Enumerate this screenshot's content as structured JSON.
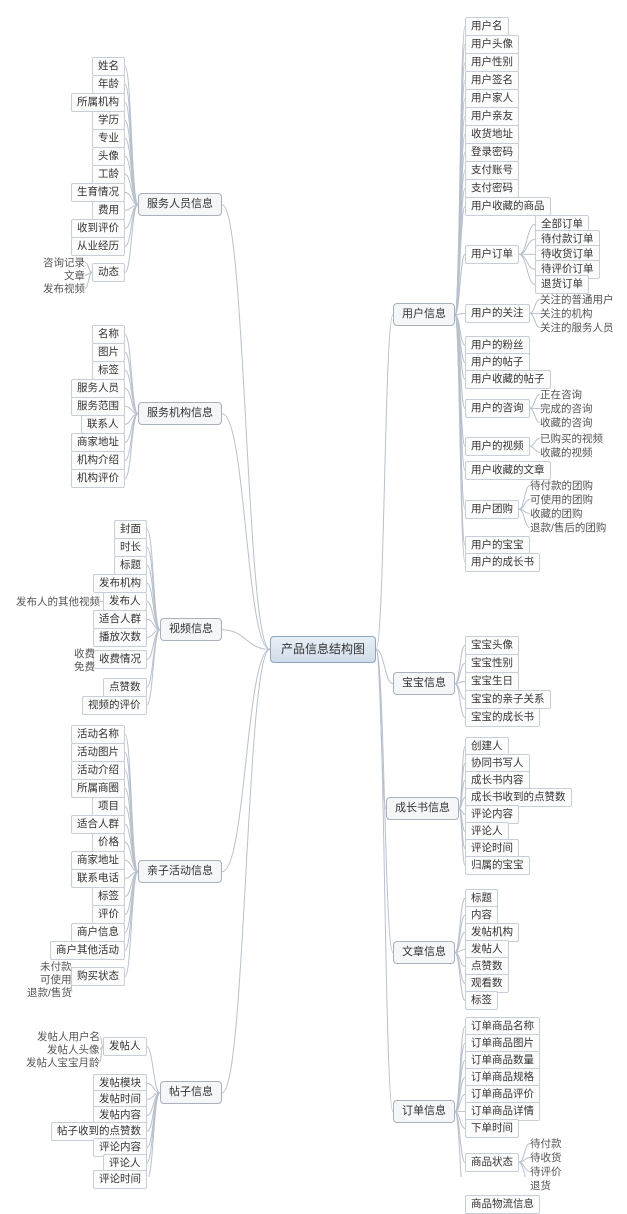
{
  "root": "产品信息结构图",
  "chart_data": {
    "type": "mindmap",
    "root": "产品信息结构图",
    "branches": [
      {
        "side": "right",
        "name": "用户信息",
        "children": [
          {
            "name": "用户名"
          },
          {
            "name": "用户头像"
          },
          {
            "name": "用户性别"
          },
          {
            "name": "用户签名"
          },
          {
            "name": "用户家人"
          },
          {
            "name": "用户亲友"
          },
          {
            "name": "收货地址"
          },
          {
            "name": "登录密码"
          },
          {
            "name": "支付账号"
          },
          {
            "name": "支付密码"
          },
          {
            "name": "用户收藏的商品"
          },
          {
            "name": "用户订单",
            "children": [
              "全部订单",
              "待付款订单",
              "待收货订单",
              "待评价订单",
              "退货订单"
            ]
          },
          {
            "name": "用户的关注",
            "children": [
              "关注的普通用户",
              "关注的机构",
              "关注的服务人员"
            ]
          },
          {
            "name": "用户的粉丝"
          },
          {
            "name": "用户的帖子"
          },
          {
            "name": "用户收藏的帖子"
          },
          {
            "name": "用户的咨询",
            "children": [
              "正在咨询",
              "完成的咨询",
              "收藏的咨询"
            ]
          },
          {
            "name": "用户的视频",
            "children": [
              "已购买的视频",
              "收藏的视频"
            ]
          },
          {
            "name": "用户收藏的文章"
          },
          {
            "name": "用户团购",
            "children": [
              "待付款的团购",
              "可使用的团购",
              "收藏的团购",
              "退款/售后的团购"
            ]
          },
          {
            "name": "用户的宝宝"
          },
          {
            "name": "用户的成长书"
          }
        ]
      },
      {
        "side": "right",
        "name": "宝宝信息",
        "children": [
          {
            "name": "宝宝头像"
          },
          {
            "name": "宝宝性别"
          },
          {
            "name": "宝宝生日"
          },
          {
            "name": "宝宝的亲子关系"
          },
          {
            "name": "宝宝的成长书"
          }
        ]
      },
      {
        "side": "right",
        "name": "成长书信息",
        "children": [
          {
            "name": "创建人"
          },
          {
            "name": "协同书写人"
          },
          {
            "name": "成长书内容"
          },
          {
            "name": "成长书收到的点赞数"
          },
          {
            "name": "评论内容"
          },
          {
            "name": "评论人"
          },
          {
            "name": "评论时间"
          },
          {
            "name": "归属的宝宝"
          }
        ]
      },
      {
        "side": "right",
        "name": "文章信息",
        "children": [
          {
            "name": "标题"
          },
          {
            "name": "内容"
          },
          {
            "name": "发帖机构"
          },
          {
            "name": "发帖人"
          },
          {
            "name": "点赞数"
          },
          {
            "name": "观看数"
          },
          {
            "name": "标签"
          }
        ]
      },
      {
        "side": "right",
        "name": "订单信息",
        "children": [
          {
            "name": "订单商品名称"
          },
          {
            "name": "订单商品图片"
          },
          {
            "name": "订单商品数量"
          },
          {
            "name": "订单商品规格"
          },
          {
            "name": "订单商品评价"
          },
          {
            "name": "订单商品详情"
          },
          {
            "name": "下单时间"
          },
          {
            "name": "商品状态",
            "children": [
              "待付款",
              "待收货",
              "待评价",
              "退货"
            ]
          },
          {
            "name": "商品物流信息"
          }
        ]
      },
      {
        "side": "left",
        "name": "服务人员信息",
        "children": [
          {
            "name": "姓名"
          },
          {
            "name": "年龄"
          },
          {
            "name": "所属机构"
          },
          {
            "name": "学历"
          },
          {
            "name": "专业"
          },
          {
            "name": "头像"
          },
          {
            "name": "工龄"
          },
          {
            "name": "生育情况"
          },
          {
            "name": "费用"
          },
          {
            "name": "收到评价"
          },
          {
            "name": "从业经历"
          },
          {
            "name": "动态",
            "children": [
              "咨询记录",
              "文章",
              "发布视频"
            ]
          }
        ]
      },
      {
        "side": "left",
        "name": "服务机构信息",
        "children": [
          {
            "name": "名称"
          },
          {
            "name": "图片"
          },
          {
            "name": "标签"
          },
          {
            "name": "服务人员"
          },
          {
            "name": "服务范围"
          },
          {
            "name": "联系人"
          },
          {
            "name": "商家地址"
          },
          {
            "name": "机构介绍"
          },
          {
            "name": "机构评价"
          }
        ]
      },
      {
        "side": "left",
        "name": "视频信息",
        "children": [
          {
            "name": "封面"
          },
          {
            "name": "时长"
          },
          {
            "name": "标题"
          },
          {
            "name": "发布机构"
          },
          {
            "name": "发布人",
            "children": [
              "发布人的其他视频"
            ]
          },
          {
            "name": "适合人群"
          },
          {
            "name": "播放次数"
          },
          {
            "name": "收费情况",
            "children": [
              "收费",
              "免费"
            ]
          },
          {
            "name": "点赞数"
          },
          {
            "name": "视频的评价"
          }
        ]
      },
      {
        "side": "left",
        "name": "亲子活动信息",
        "children": [
          {
            "name": "活动名称"
          },
          {
            "name": "活动图片"
          },
          {
            "name": "活动介绍"
          },
          {
            "name": "所属商圈"
          },
          {
            "name": "项目"
          },
          {
            "name": "适合人群"
          },
          {
            "name": "价格"
          },
          {
            "name": "商家地址"
          },
          {
            "name": "联系电话"
          },
          {
            "name": "标签"
          },
          {
            "name": "评价"
          },
          {
            "name": "商户信息"
          },
          {
            "name": "商户其他活动"
          },
          {
            "name": "购买状态",
            "children": [
              "未付款",
              "可使用",
              "退款/售货"
            ]
          }
        ]
      },
      {
        "side": "left",
        "name": "帖子信息",
        "children": [
          {
            "name": "发帖人",
            "children": [
              "发帖人用户名",
              "发帖人头像",
              "发帖人宝宝月龄"
            ]
          },
          {
            "name": "发帖模块"
          },
          {
            "name": "发帖时间"
          },
          {
            "name": "发帖内容"
          },
          {
            "name": "帖子收到的点赞数"
          },
          {
            "name": "评论内容"
          },
          {
            "name": "评论人"
          },
          {
            "name": "评论时间"
          }
        ]
      }
    ]
  },
  "right": {
    "user": {
      "title": "用户信息",
      "items": [
        "用户名",
        "用户头像",
        "用户性别",
        "用户签名",
        "用户家人",
        "用户亲友",
        "收货地址",
        "登录密码",
        "支付账号",
        "支付密码",
        "用户收藏的商品"
      ],
      "orders": {
        "title": "用户订单",
        "items": [
          "全部订单",
          "待付款订单",
          "待收货订单",
          "待评价订单",
          "退货订单"
        ]
      },
      "follow": {
        "title": "用户的关注",
        "items": [
          "关注的普通用户",
          "关注的机构",
          "关注的服务人员"
        ]
      },
      "fans": "用户的粉丝",
      "posts": "用户的帖子",
      "favposts": "用户收藏的帖子",
      "consult": {
        "title": "用户的咨询",
        "items": [
          "正在咨询",
          "完成的咨询",
          "收藏的咨询"
        ]
      },
      "video": {
        "title": "用户的视频",
        "items": [
          "已购买的视频",
          "收藏的视频"
        ]
      },
      "favarticle": "用户收藏的文章",
      "group": {
        "title": "用户团购",
        "items": [
          "待付款的团购",
          "可使用的团购",
          "收藏的团购",
          "退款/售后的团购"
        ]
      },
      "baby": "用户的宝宝",
      "growth": "用户的成长书"
    },
    "baby": {
      "title": "宝宝信息",
      "items": [
        "宝宝头像",
        "宝宝性别",
        "宝宝生日",
        "宝宝的亲子关系",
        "宝宝的成长书"
      ]
    },
    "growth": {
      "title": "成长书信息",
      "items": [
        "创建人",
        "协同书写人",
        "成长书内容",
        "成长书收到的点赞数",
        "评论内容",
        "评论人",
        "评论时间",
        "归属的宝宝"
      ]
    },
    "article": {
      "title": "文章信息",
      "items": [
        "标题",
        "内容",
        "发帖机构",
        "发帖人",
        "点赞数",
        "观看数",
        "标签"
      ]
    },
    "order": {
      "title": "订单信息",
      "items": [
        "订单商品名称",
        "订单商品图片",
        "订单商品数量",
        "订单商品规格",
        "订单商品评价",
        "订单商品详情",
        "下单时间"
      ],
      "status": {
        "title": "商品状态",
        "items": [
          "待付款",
          "待收货",
          "待评价",
          "退货"
        ]
      },
      "logistics": "商品物流信息"
    }
  },
  "left": {
    "staff": {
      "title": "服务人员信息",
      "items": [
        "姓名",
        "年龄",
        "所属机构",
        "学历",
        "专业",
        "头像",
        "工龄",
        "生育情况",
        "费用",
        "收到评价",
        "从业经历"
      ],
      "dynamic": {
        "title": "动态",
        "items": [
          "咨询记录",
          "文章",
          "发布视频"
        ]
      }
    },
    "org": {
      "title": "服务机构信息",
      "items": [
        "名称",
        "图片",
        "标签",
        "服务人员",
        "服务范围",
        "联系人",
        "商家地址",
        "机构介绍",
        "机构评价"
      ]
    },
    "video": {
      "title": "视频信息",
      "items": [
        "封面",
        "时长",
        "标题",
        "发布机构"
      ],
      "publisher": {
        "title": "发布人",
        "items": [
          "发布人的其他视频"
        ]
      },
      "items2": [
        "适合人群",
        "播放次数"
      ],
      "fee": {
        "title": "收费情况",
        "items": [
          "收费",
          "免费"
        ]
      },
      "items3": [
        "点赞数",
        "视频的评价"
      ]
    },
    "activity": {
      "title": "亲子活动信息",
      "items": [
        "活动名称",
        "活动图片",
        "活动介绍",
        "所属商圈",
        "项目",
        "适合人群",
        "价格",
        "商家地址",
        "联系电话",
        "标签",
        "评价",
        "商户信息",
        "商户其他活动"
      ],
      "buy": {
        "title": "购买状态",
        "items": [
          "未付款",
          "可使用",
          "退款/售货"
        ]
      }
    },
    "post": {
      "title": "帖子信息",
      "poster": {
        "title": "发帖人",
        "items": [
          "发帖人用户名",
          "发帖人头像",
          "发帖人宝宝月龄"
        ]
      },
      "items": [
        "发帖模块",
        "发帖时间",
        "发帖内容",
        "帖子收到的点赞数",
        "评论内容",
        "评论人",
        "评论时间"
      ]
    }
  }
}
